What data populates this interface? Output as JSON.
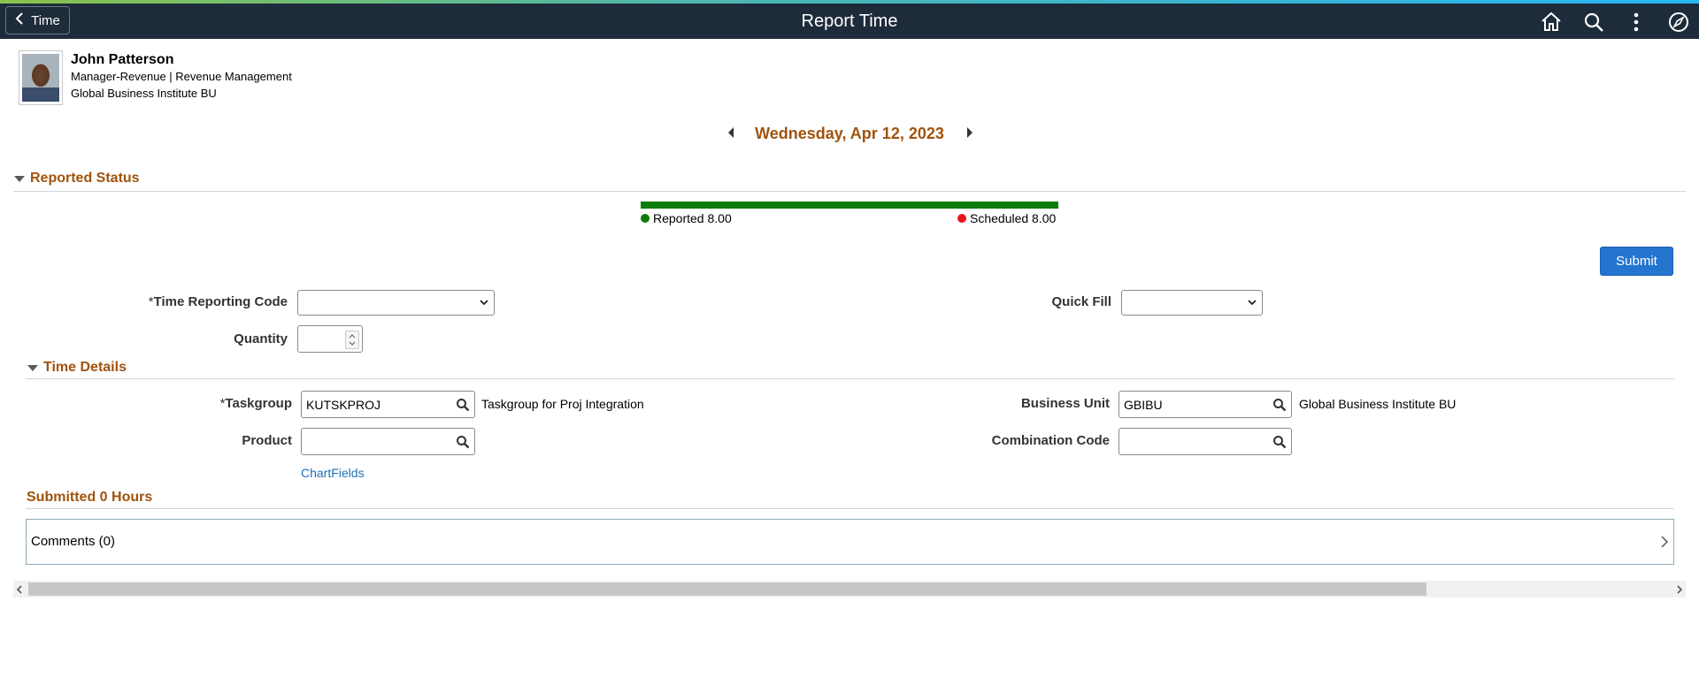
{
  "header": {
    "back_label": "Time",
    "title": "Report Time",
    "icons": [
      "home-icon",
      "search-icon",
      "more-options-icon",
      "navbar-icon"
    ]
  },
  "employee": {
    "name": "John Patterson",
    "title": "Manager-Revenue | Revenue Management",
    "business_unit": "Global Business Institute BU"
  },
  "date_nav": {
    "date": "Wednesday, Apr 12, 2023"
  },
  "reported_status": {
    "heading": "Reported Status",
    "reported_label": "Reported 8.00",
    "scheduled_label": "Scheduled 8.00",
    "reported_color": "#0a7d0a",
    "scheduled_color": "#e8141c",
    "bar_fill_fraction": 1.0
  },
  "actions": {
    "submit_label": "Submit"
  },
  "form": {
    "time_reporting_code": {
      "required_mark": "*",
      "label": "Time Reporting Code",
      "value": ""
    },
    "quick_fill": {
      "label": "Quick Fill",
      "value": ""
    },
    "quantity": {
      "label": "Quantity",
      "value": ""
    }
  },
  "time_details": {
    "heading": "Time Details",
    "taskgroup": {
      "required_mark": "*",
      "label": "Taskgroup",
      "value": "KUTSKPROJ",
      "description": "Taskgroup for Proj Integration"
    },
    "business_unit": {
      "label": "Business Unit",
      "value": "GBIBU",
      "description": "Global Business Institute BU"
    },
    "product": {
      "label": "Product",
      "value": ""
    },
    "combination_code": {
      "label": "Combination Code",
      "value": ""
    },
    "chartfields_link": "ChartFields"
  },
  "submitted": {
    "heading": "Submitted 0 Hours"
  },
  "comments": {
    "label": "Comments (0)"
  },
  "colors": {
    "header_bg": "#1d2b3a",
    "section_heading": "#a0530d",
    "primary_button": "#2475d0",
    "link": "#1f6fb5"
  }
}
